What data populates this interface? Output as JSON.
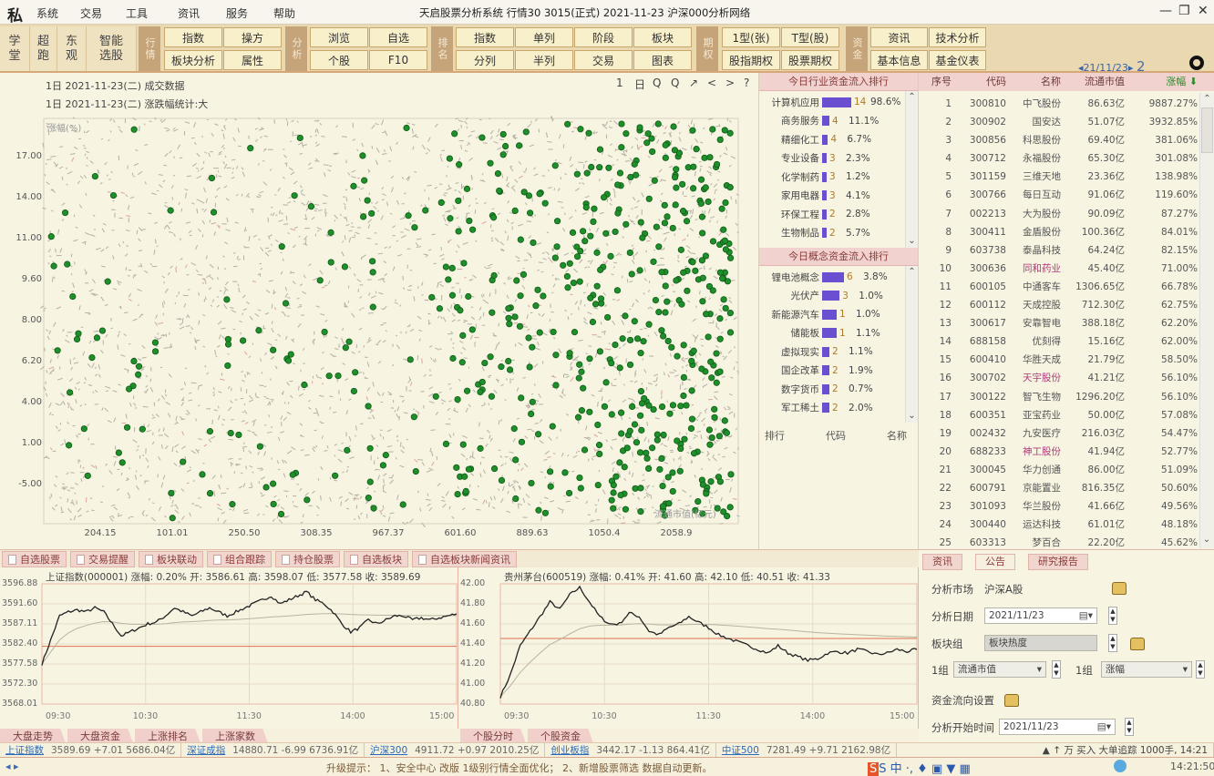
{
  "titlebar": {
    "menu": [
      "系统",
      "交易",
      "工具",
      "资讯",
      "服务",
      "帮助"
    ],
    "title": "天启股票分析系统  行情30 3015(正式)  2021-11-23  沪深000分析网络",
    "controls": [
      "—",
      "❐",
      "✕"
    ]
  },
  "toolbar": {
    "shortcuts": [
      "学\n堂",
      "超\n跑",
      "东\n观",
      "智能\n选股"
    ],
    "groups": [
      {
        "label": "行情",
        "buttons": [
          "指数",
          "操方",
          "板块分析",
          "属性"
        ]
      },
      {
        "label": "分析",
        "buttons": [
          "浏览",
          "自选",
          "个股",
          "F10"
        ]
      },
      {
        "label": "排名",
        "buttons": [
          "指数",
          "单列",
          "阶段",
          "板块",
          "分列",
          "半列",
          "交易",
          "图表"
        ]
      },
      {
        "label": "期权",
        "buttons": [
          "1型(张)",
          "T型(股)",
          "股指期权",
          "股票期权"
        ]
      },
      {
        "label": "资金",
        "buttons": [
          "资讯",
          "技术分析",
          "基本信息",
          "基金仪表"
        ]
      }
    ],
    "date_nav": "◂21/11/23▸",
    "date_icon": "2"
  },
  "scatter": {
    "header_line1": "1日   2021-11-23(二)    成交数据",
    "header_line2": "1日   2021-11-23(二)    涨跌幅统计:大",
    "tools": [
      "1",
      "日",
      "Q",
      "Q",
      "↗",
      "<",
      ">",
      "?"
    ],
    "chart_data": {
      "type": "scatter",
      "ylabel": "涨幅(%)",
      "xlabel": "流通市值(亿元)",
      "y_ticks": [
        "17.00",
        "14.00",
        "11.00",
        "9.60",
        "8.00",
        "6.20",
        "4.00",
        "1.00",
        "-5.00"
      ],
      "x_ticks": [
        "204.15",
        "101.01",
        "250.50",
        "308.35",
        "967.37",
        "601.60",
        "889.63",
        "1050.4",
        "2058.9"
      ],
      "point_color": "#1f8f2a"
    }
  },
  "sectors": {
    "header1": "今日行业资金流入排行",
    "list1": [
      {
        "name": "计算机应用",
        "count": "14",
        "pct": "98.6%",
        "bar": 1.0
      },
      {
        "name": "商务服务",
        "count": "4",
        "pct": "11.1%",
        "bar": 0.25
      },
      {
        "name": "精细化工",
        "count": "4",
        "pct": "6.7%",
        "bar": 0.2
      },
      {
        "name": "专业设备",
        "count": "3",
        "pct": "2.3%",
        "bar": 0.15
      },
      {
        "name": "化学制药",
        "count": "3",
        "pct": "1.2%",
        "bar": 0.15
      },
      {
        "name": "家用电器",
        "count": "3",
        "pct": "4.1%",
        "bar": 0.15
      },
      {
        "name": "环保工程",
        "count": "2",
        "pct": "2.8%",
        "bar": 0.1
      },
      {
        "name": "生物制品",
        "count": "2",
        "pct": "5.7%",
        "bar": 0.1
      }
    ],
    "header2": "今日概念资金流入排行",
    "list2": [
      {
        "name": "锂电池概念",
        "count": "6",
        "pct": "3.8%",
        "bar": 0.75
      },
      {
        "name": "光伏产",
        "count": "3",
        "pct": "1.0%",
        "bar": 0.6
      },
      {
        "name": "新能源汽车",
        "count": "1",
        "pct": "1.0%",
        "bar": 0.5
      },
      {
        "name": "储能板",
        "count": "1",
        "pct": "1.1%",
        "bar": 0.5
      },
      {
        "name": "虚拟现实",
        "count": "2",
        "pct": "1.1%",
        "bar": 0.25
      },
      {
        "name": "国企改革",
        "count": "2",
        "pct": "1.9%",
        "bar": 0.25
      },
      {
        "name": "数字货币",
        "count": "2",
        "pct": "0.7%",
        "bar": 0.25
      },
      {
        "name": "军工稀土",
        "count": "2",
        "pct": "2.0%",
        "bar": 0.25
      }
    ],
    "footer": [
      "排行",
      "代码",
      "名称"
    ]
  },
  "ranking": {
    "columns": [
      "序号",
      "代码",
      "名称",
      "流通市值",
      "涨幅 ⬇"
    ],
    "rows": [
      [
        "1",
        "300810",
        "中飞股份",
        "86.63亿",
        "9887.27%",
        false
      ],
      [
        "2",
        "300902",
        "国安达",
        "51.07亿",
        "3932.85%",
        false
      ],
      [
        "3",
        "300856",
        "科思股份",
        "69.40亿",
        "381.06%",
        false
      ],
      [
        "4",
        "300712",
        "永福股份",
        "65.30亿",
        "301.08%",
        false
      ],
      [
        "5",
        "301159",
        "三维天地",
        "23.36亿",
        "138.98%",
        false
      ],
      [
        "6",
        "300766",
        "每日互动",
        "91.06亿",
        "119.60%",
        false
      ],
      [
        "7",
        "002213",
        "大为股份",
        "90.09亿",
        "87.27%",
        false
      ],
      [
        "8",
        "300411",
        "金盾股份",
        "100.36亿",
        "84.01%",
        false
      ],
      [
        "9",
        "603738",
        "泰晶科技",
        "64.24亿",
        "82.15%",
        false
      ],
      [
        "10",
        "300636",
        "同和药业",
        "45.40亿",
        "71.00%",
        true
      ],
      [
        "11",
        "600105",
        "中通客车",
        "1306.65亿",
        "66.78%",
        false
      ],
      [
        "12",
        "600112",
        "天成控股",
        "712.30亿",
        "62.75%",
        false
      ],
      [
        "13",
        "300617",
        "安靠智电",
        "388.18亿",
        "62.20%",
        false
      ],
      [
        "14",
        "688158",
        "优刻得",
        "15.16亿",
        "62.00%",
        false
      ],
      [
        "15",
        "600410",
        "华胜天成",
        "21.79亿",
        "58.50%",
        false
      ],
      [
        "16",
        "300702",
        "天宇股份",
        "41.21亿",
        "56.10%",
        true
      ],
      [
        "17",
        "300122",
        "智飞生物",
        "1296.20亿",
        "56.10%",
        false
      ],
      [
        "18",
        "600351",
        "亚宝药业",
        "50.00亿",
        "57.08%",
        false
      ],
      [
        "19",
        "002432",
        "九安医疗",
        "216.03亿",
        "54.47%",
        false
      ],
      [
        "20",
        "688233",
        "神工股份",
        "41.94亿",
        "52.77%",
        true
      ],
      [
        "21",
        "300045",
        "华力创通",
        "86.00亿",
        "51.09%",
        false
      ],
      [
        "22",
        "600791",
        "京能置业",
        "816.35亿",
        "50.60%",
        false
      ],
      [
        "23",
        "301093",
        "华兰股份",
        "41.66亿",
        "49.56%",
        false
      ],
      [
        "24",
        "300440",
        "运达科技",
        "61.01亿",
        "48.18%",
        false
      ],
      [
        "25",
        "603313",
        "梦百合",
        "22.20亿",
        "45.62%",
        false
      ]
    ]
  },
  "tabs": [
    "自选股票",
    "交易提醒",
    "板块联动",
    "组合跟踪",
    "持仓股票",
    "自选板块",
    "自选板块新闻资讯"
  ],
  "mini_left": {
    "header": "上证指数(000001)  涨幅: 0.20%  开: 3586.61  高: 3598.07  低: 3577.58  收: 3589.69",
    "chart_data": {
      "type": "line",
      "y_ticks": [
        "3596.88",
        "3591.60",
        "3587.11",
        "3582.40",
        "3577.58",
        "3572.30",
        "3568.01"
      ],
      "x_ticks": [
        "09:30",
        "10:30",
        "11:30",
        "14:00",
        "15:00"
      ],
      "ylim": [
        3568,
        3598
      ],
      "ref": 3582.4,
      "values": [
        3578,
        3584,
        3590,
        3591,
        3591.5,
        3591,
        3592,
        3591,
        3588,
        3585,
        3586,
        3587,
        3588,
        3588.5,
        3590,
        3592,
        3591,
        3590,
        3591,
        3592,
        3591,
        3590,
        3591,
        3592,
        3593,
        3594,
        3595,
        3593,
        3594,
        3595,
        3596,
        3594,
        3593,
        3591,
        3588,
        3586,
        3587,
        3589,
        3588,
        3589,
        3590,
        3590,
        3589,
        3589.5,
        3589,
        3589.5,
        3590,
        3590.5
      ],
      "line_color": "#222",
      "ref_color": "#e07050"
    },
    "tabs": [
      "大盘走势",
      "大盘资金",
      "上涨排名",
      "上涨家数"
    ]
  },
  "mini_right": {
    "header": "贵州茅台(600519)  涨幅: 0.41%  开: 41.60  高: 42.10  低: 40.51  收: 41.33",
    "chart_data": {
      "type": "line",
      "y_ticks": [
        "42.00",
        "41.80",
        "41.60",
        "41.40",
        "41.20",
        "41.00",
        "40.80"
      ],
      "x_ticks": [
        "09:30",
        "10:30",
        "11:30",
        "14:00",
        "15:00"
      ],
      "ylim": [
        40.5,
        42.15
      ],
      "ref": 41.4,
      "values": [
        40.6,
        40.9,
        41.3,
        41.5,
        41.7,
        41.9,
        41.8,
        42.0,
        42.1,
        41.9,
        41.7,
        41.6,
        41.6,
        41.75,
        41.7,
        41.5,
        41.45,
        41.55,
        41.6,
        41.7,
        41.62,
        41.55,
        41.45,
        41.4,
        41.35,
        41.3,
        41.25,
        41.2,
        41.3,
        41.2,
        41.15,
        41.1,
        41.12,
        41.2,
        41.22,
        41.2,
        41.25,
        41.22,
        41.18,
        41.2,
        41.25,
        41.22,
        41.25
      ],
      "line_color": "#222",
      "ref_color": "#e07050"
    },
    "tabs": [
      "个股分时",
      "个股资金"
    ]
  },
  "rpanel": {
    "tabs": [
      "资讯",
      "公告",
      "研究报告"
    ],
    "market_label": "分析市场",
    "market_value": "沪深A股",
    "date_label": "分析日期",
    "date_value": "2021/11/23",
    "group_label": "板块组",
    "group_value": "板块热度",
    "g1_label": "1组",
    "g1_value": "流通市值",
    "g2_label": "1组",
    "g2_value": "涨幅",
    "flow_label": "资金流向设置",
    "start_label": "分析开始时间",
    "start_value": "2021/11/23"
  },
  "ticker": [
    {
      "name": "上证指数",
      "text": "3589.69  +7.01  5686.04亿"
    },
    {
      "name": "深证成指",
      "text": "14880.71  -6.99  6736.91亿"
    },
    {
      "name": "沪深300",
      "text": "4911.72  +0.97  2010.25亿"
    },
    {
      "name": "创业板指",
      "text": "3442.17  -1.13  864.41亿"
    },
    {
      "name": "中证500",
      "text": "7281.49  +9.71  2162.98亿"
    }
  ],
  "ticker_right": "▲ ↑ 万  买入  大单追踪  1000手, 14:21",
  "status": {
    "left": "◂ ▸",
    "message": "升级提示： 1、安全中心 改版 1级别行情全面优化； 2、新增股票筛选 数据自动更新。",
    "ime": "S 中 ·, ♦ ▣ ▼ ▦",
    "clock": "14:21:50"
  }
}
